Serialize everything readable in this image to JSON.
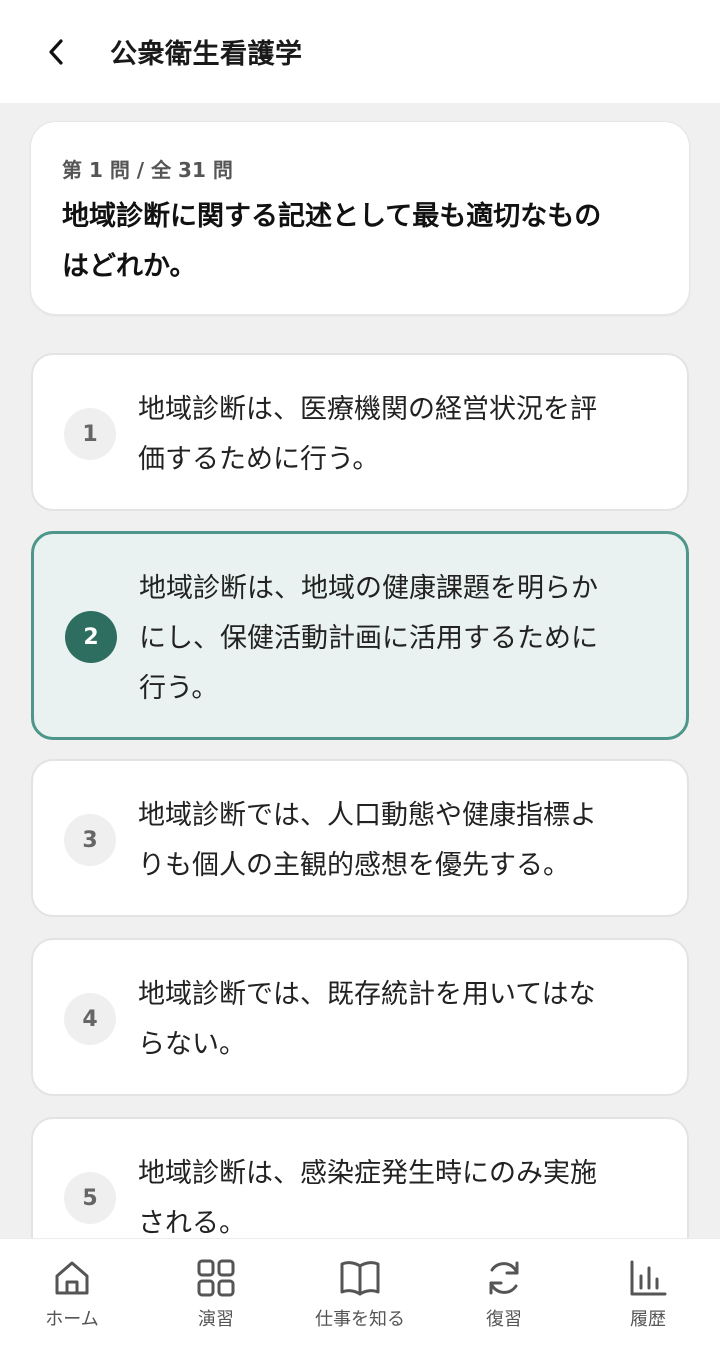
{
  "header": {
    "title": "公衆衛生看護学"
  },
  "question": {
    "counter": "第 1 問 / 全 31 問",
    "line1": "地域診断に関する記述として最も適切なもの",
    "line2": "はどれか。"
  },
  "options": [
    {
      "num": "1",
      "line1": "地域診断は、医療機関の経営状況を評",
      "line2": "価するために行う。",
      "line3": "",
      "selected": false
    },
    {
      "num": "2",
      "line1": "地域診断は、地域の健康課題を明らか",
      "line2": "にし、保健活動計画に活用するために",
      "line3": "行う。",
      "selected": true
    },
    {
      "num": "3",
      "line1": "地域診断では、人口動態や健康指標よ",
      "line2": "りも個人の主観的感想を優先する。",
      "line3": "",
      "selected": false
    },
    {
      "num": "4",
      "line1": "地域診断では、既存統計を用いてはな",
      "line2": "らない。",
      "line3": "",
      "selected": false
    },
    {
      "num": "5",
      "line1": "地域診断は、感染症発生時にのみ実施",
      "line2": "される。",
      "line3": "",
      "selected": false
    }
  ],
  "nav": [
    {
      "label": "ホーム",
      "icon": "home-icon"
    },
    {
      "label": "演習",
      "icon": "grid-icon"
    },
    {
      "label": "仕事を知る",
      "icon": "book-icon"
    },
    {
      "label": "復習",
      "icon": "refresh-icon"
    },
    {
      "label": "履歴",
      "icon": "bar-chart-icon"
    }
  ],
  "colors": {
    "accent": "#2e6e61",
    "selected_bg": "#e9f2f0",
    "selected_border": "#4e958a"
  }
}
